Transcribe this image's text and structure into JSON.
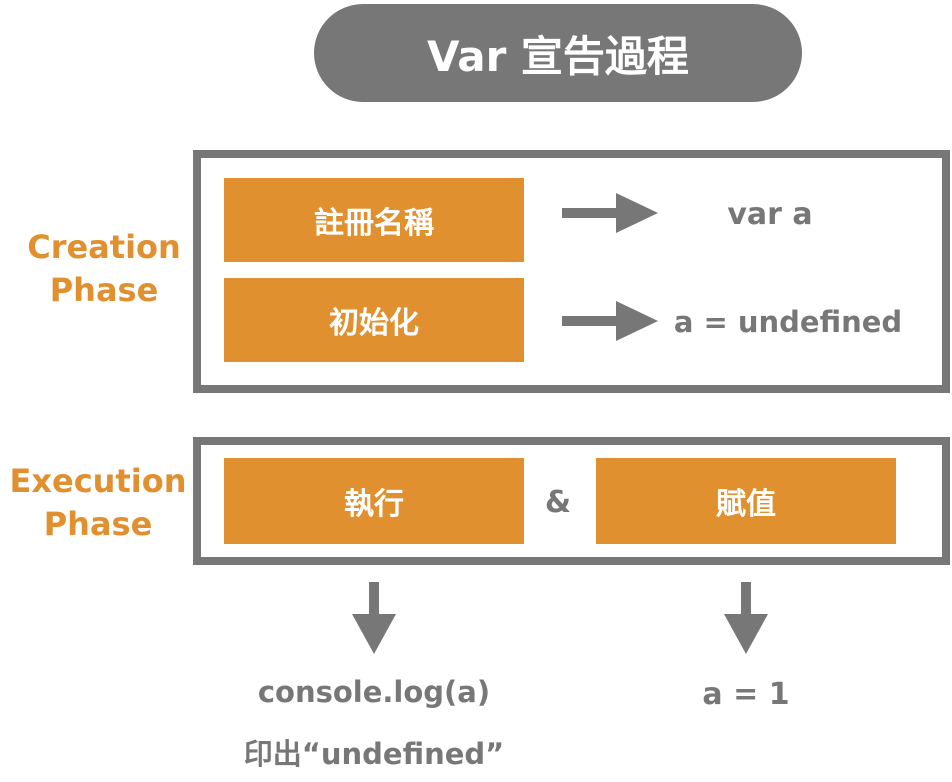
{
  "title": "Var 宣告過程",
  "creation": {
    "label_line1": "Creation",
    "label_line2": "Phase",
    "step1": "註冊名稱",
    "step1_result": "var  a",
    "step2": "初始化",
    "step2_result": "a = undefined"
  },
  "execution": {
    "label_line1": "Execution",
    "label_line2": "Phase",
    "step_left": "執行",
    "joiner": "&",
    "step_right": "賦值",
    "left_output_line1": "console.log(a)",
    "left_output_line2": "印出“undefined”",
    "right_output": "a = 1"
  },
  "colors": {
    "accent": "#e0902f",
    "gray": "#777777",
    "background": "#ffffff"
  }
}
